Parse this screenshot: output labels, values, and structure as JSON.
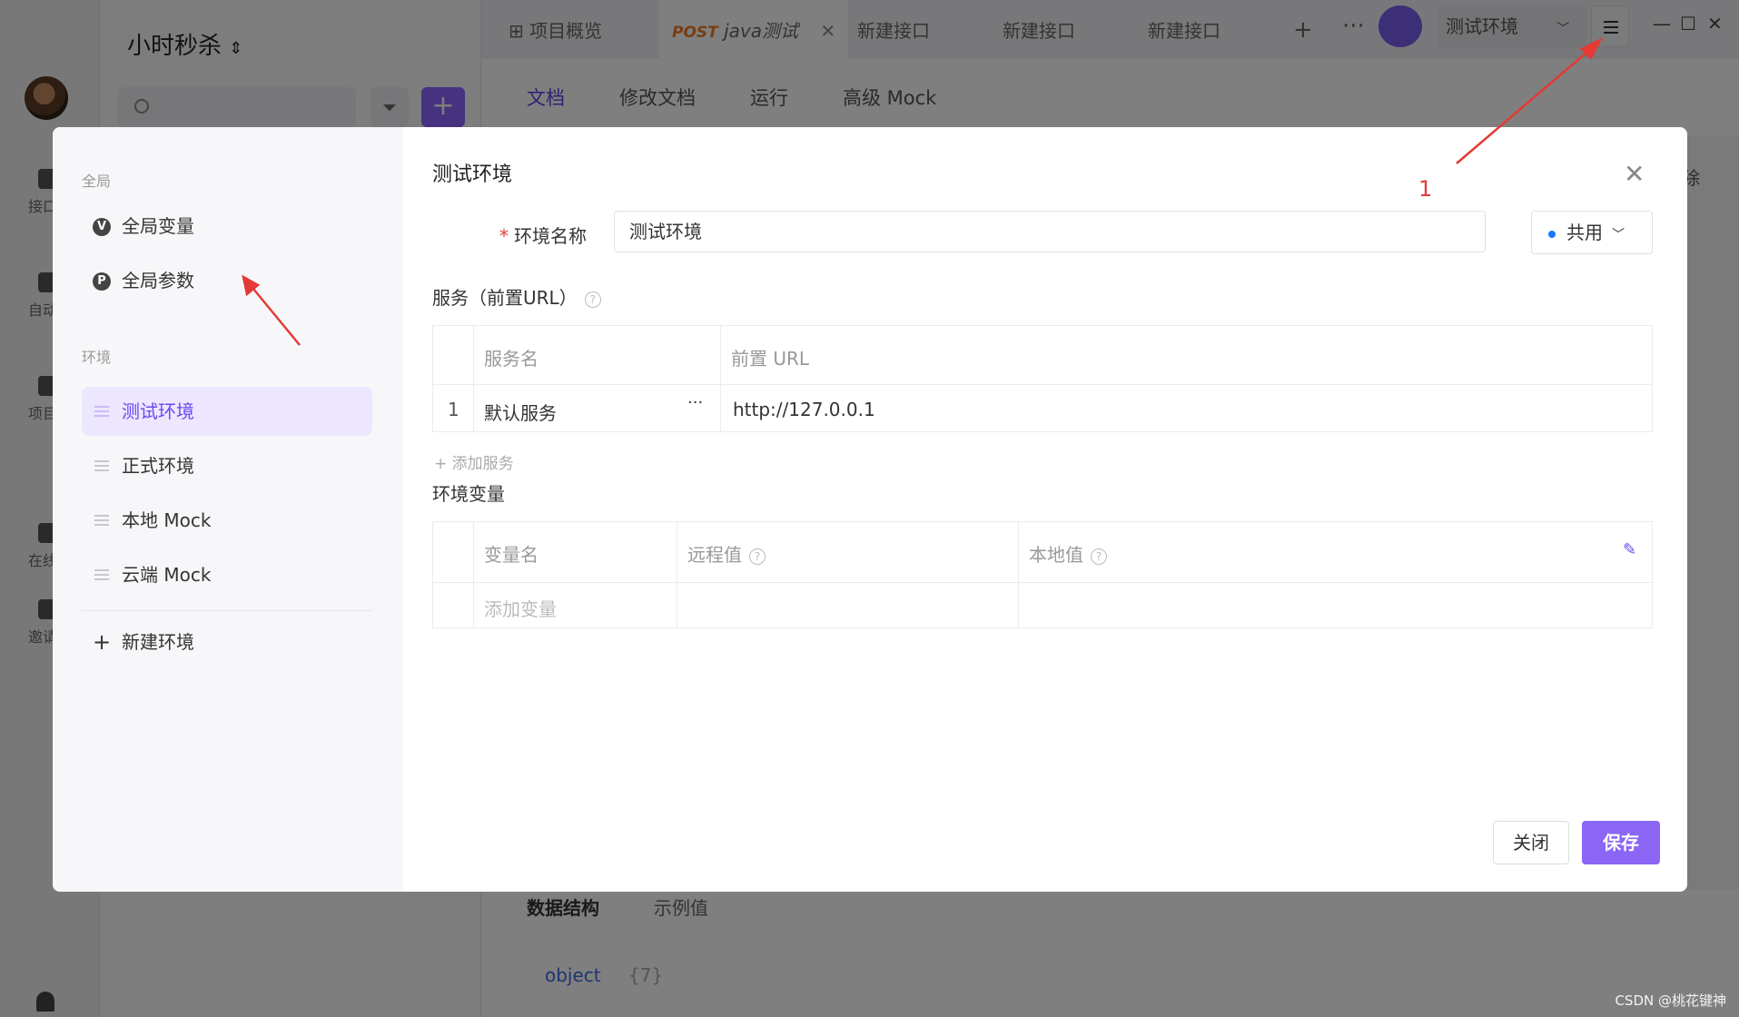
{
  "project": {
    "title": "小时秒杀",
    "switch_icon": "up-down-chevron-icon"
  },
  "rail": {
    "items": [
      {
        "label": "接口管"
      },
      {
        "label": "自动化"
      },
      {
        "label": "项目设"
      },
      {
        "label": "在线分"
      },
      {
        "label": "邀请成"
      }
    ]
  },
  "topbar": {
    "tabs": [
      {
        "label": "项目概览"
      },
      {
        "method": "POST",
        "label": "java测试"
      },
      {
        "label": "新建接口"
      },
      {
        "label": "新建接口"
      },
      {
        "label": "新建接口"
      }
    ],
    "add_tab": "+",
    "more": "···",
    "env_selected": "测试环境",
    "window_controls": {
      "minimize": "—",
      "maximize": "☐",
      "close": "✕"
    }
  },
  "subtabs": [
    "文档",
    "修改文档",
    "运行",
    "高级 Mock"
  ],
  "bottom": {
    "tabs": [
      "数据结构",
      "示例值"
    ],
    "object_label": "object",
    "object_count": "{7}",
    "delete_fragment": "除"
  },
  "modal": {
    "title": "测试环境",
    "side": {
      "global_group": "全局",
      "global_items": [
        {
          "label": "全局变量",
          "badge": "V"
        },
        {
          "label": "全局参数",
          "badge": "P"
        }
      ],
      "env_group": "环境",
      "env_items": [
        {
          "label": "测试环境",
          "active": true
        },
        {
          "label": "正式环境"
        },
        {
          "label": "本地 Mock"
        },
        {
          "label": "云端 Mock"
        }
      ],
      "new_env": "新建环境"
    },
    "form": {
      "required_mark": "*",
      "name_label": "环境名称",
      "name_value": "测试环境",
      "share_value": "共用"
    },
    "services": {
      "label": "服务（前置URL）",
      "columns": [
        "服务名",
        "前置 URL"
      ],
      "rows": [
        {
          "index": "1",
          "name": "默认服务",
          "url": "http://127.0.0.1"
        }
      ],
      "add": "+ 添加服务"
    },
    "variables": {
      "label": "环境变量",
      "columns": [
        "变量名",
        "远程值",
        "本地值"
      ],
      "placeholder": "添加变量"
    },
    "buttons": {
      "close": "关闭",
      "save": "保存"
    }
  },
  "annotation": {
    "number": "1"
  },
  "watermark": "CSDN @桃花键神"
}
